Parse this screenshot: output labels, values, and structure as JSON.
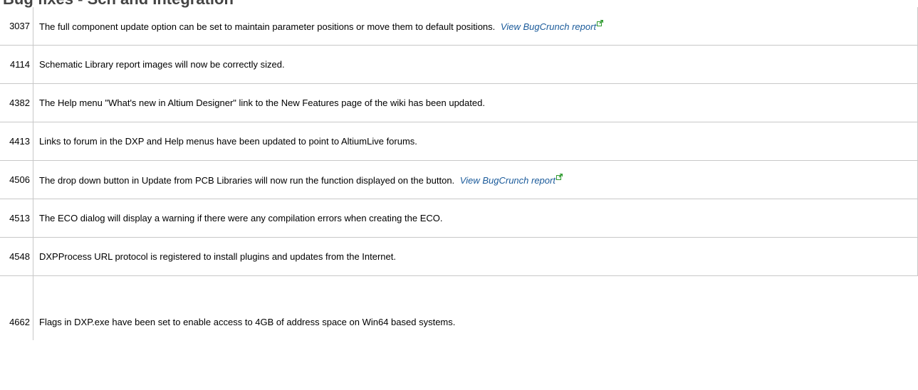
{
  "heading": "Bug fixes - Sch and Integration",
  "rows": [
    {
      "id": "3037",
      "text": "The full component update option can be set to maintain parameter positions or move them to default positions.",
      "link": "View BugCrunch report"
    },
    {
      "id": "4114",
      "text": "Schematic Library report images will now be correctly sized."
    },
    {
      "id": "4382",
      "text": "The Help menu \"What's new in Altium Designer\" link to the New Features page of the wiki has been updated."
    },
    {
      "id": "4413",
      "text": "Links to forum in the DXP and Help menus have been updated to point to AltiumLive forums."
    },
    {
      "id": "4506",
      "text": "The drop down button in Update from PCB Libraries will now run the function displayed on the button.",
      "link": "View BugCrunch report"
    },
    {
      "id": "4513",
      "text": "The ECO dialog will display a warning if there were any compilation errors when creating the ECO."
    },
    {
      "id": "4548",
      "text": "DXPProcess URL protocol is registered to install plugins and updates from the Internet."
    },
    {
      "id": "4662",
      "text": "Flags in DXP.exe have been set to enable access to 4GB of address space on Win64 based systems."
    }
  ],
  "colors": {
    "link": "#1a5a9a",
    "border": "#c8c8c8",
    "external_icon": "#2e9a2e"
  },
  "icons": {
    "external_link": "external-link-icon"
  }
}
